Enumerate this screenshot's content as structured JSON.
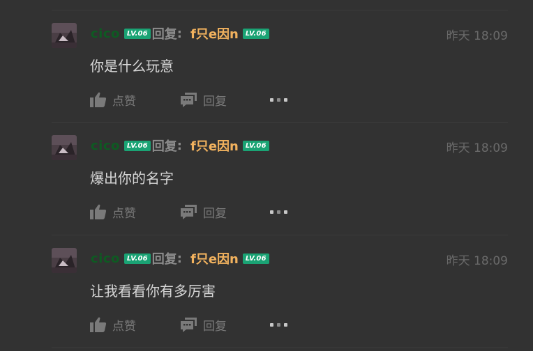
{
  "comments": [
    {
      "username": "cico",
      "user_level": "LV.06",
      "reply_word": "回复",
      "reply_colon": ":",
      "target_name": "f只e因n",
      "target_level": "LV.06",
      "timestamp": "昨天 18:09",
      "content": "你是什么玩意",
      "like_label": "点赞",
      "reply_label": "回复"
    },
    {
      "username": "cico",
      "user_level": "LV.06",
      "reply_word": "回复",
      "reply_colon": ":",
      "target_name": "f只e因n",
      "target_level": "LV.06",
      "timestamp": "昨天 18:09",
      "content": "爆出你的名字",
      "like_label": "点赞",
      "reply_label": "回复"
    },
    {
      "username": "cico",
      "user_level": "LV.06",
      "reply_word": "回复",
      "reply_colon": ":",
      "target_name": "f只e因n",
      "target_level": "LV.06",
      "timestamp": "昨天 18:09",
      "content": "让我看看你有多厉害",
      "like_label": "点赞",
      "reply_label": "回复"
    }
  ],
  "icons": {
    "like": "thumbs-up-icon",
    "reply": "comment-icon",
    "more": "more-dots-icon"
  },
  "colors": {
    "background": "#323232",
    "username": "#0e5a22",
    "level_badge": "#1aa374",
    "target_name": "#f2b25e",
    "content_text": "#d6d6d6",
    "muted": "#7a7a7a"
  }
}
